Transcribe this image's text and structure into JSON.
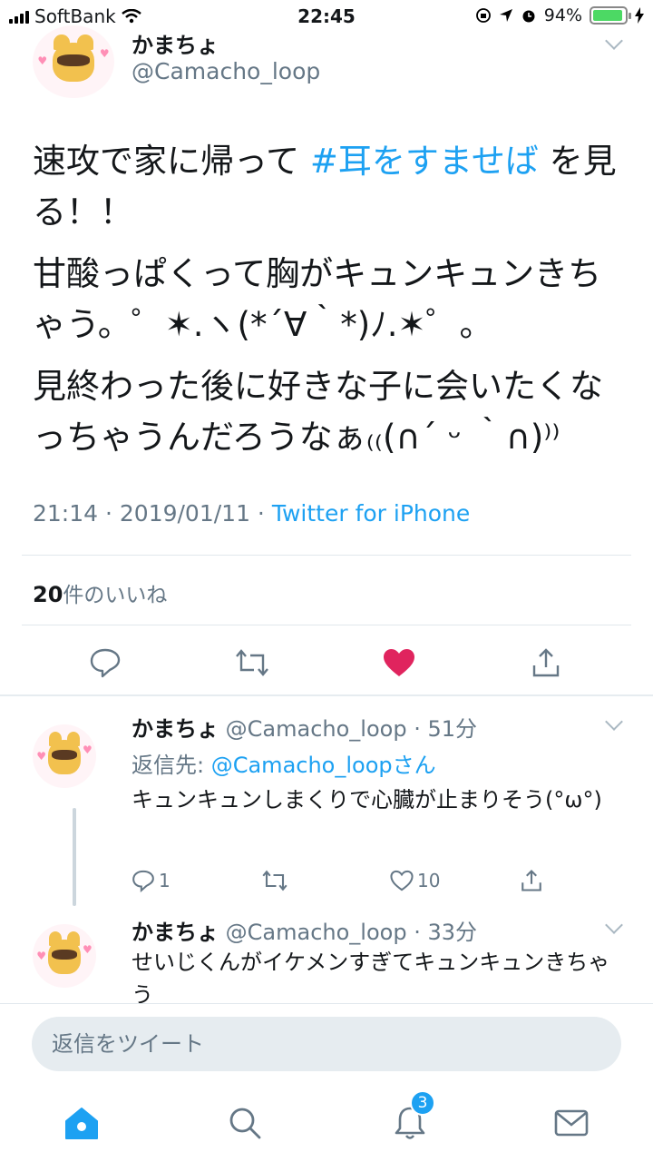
{
  "status_bar": {
    "carrier": "SoftBank",
    "time": "22:45",
    "battery": "94%",
    "battery_level": 0.94
  },
  "main_tweet": {
    "display_name": "かまちょ",
    "handle": "@Camacho_loop",
    "text_line1_before": "速攻で家に帰って ",
    "hashtag": "#耳をすませば",
    "text_line1_after": " を見る！！",
    "paragraph2": "甘酸っぱくって胸がキュンキュンきちゃう。゜✶.ヽ(*´∀｀*)ﾉ.✶゜。",
    "paragraph3": "見終わった後に好きな子に会いたくなっちゃうんだろうなぁ₍₍(∩´ ᵕ ｀∩)⁾⁾",
    "time": "21:14",
    "date": "2019/01/11",
    "source": "Twitter for iPhone",
    "like_count": "20",
    "like_label": "件のいいね"
  },
  "replies": [
    {
      "display_name": "かまちょ",
      "handle": "@Camacho_loop",
      "age": "51分",
      "reply_to_label": "返信先: ",
      "reply_to_handle": "@Camacho_loopさん",
      "text": "キュンキュンしまくりで心臓が止まりそう(°ω°)",
      "reply_count": "1",
      "like_count": "10"
    },
    {
      "display_name": "かまちょ",
      "handle": "@Camacho_loop",
      "age": "33分",
      "text": "せいじくんがイケメンすぎてキュンキュンきちゃう"
    }
  ],
  "reply_bar": {
    "placeholder": "返信をツイート"
  },
  "tab_bar": {
    "notifications_badge": "3"
  },
  "colors": {
    "accent": "#1da1f2",
    "like": "#e0245e",
    "muted": "#657786"
  },
  "icons": [
    "signal-icon",
    "wifi-icon",
    "lock-rotation-icon",
    "location-icon",
    "alarm-icon",
    "battery-icon",
    "chevron-down-icon",
    "reply-icon",
    "retweet-icon",
    "heart-icon",
    "share-icon",
    "home-icon",
    "search-icon",
    "bell-icon",
    "mail-icon"
  ]
}
